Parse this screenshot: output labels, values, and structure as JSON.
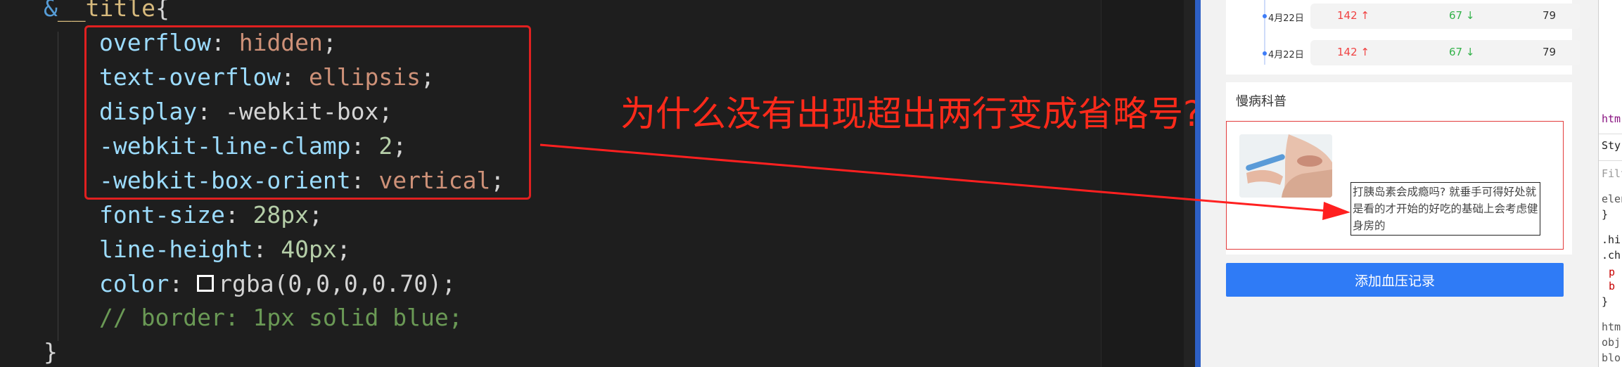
{
  "editor": {
    "lines": [
      {
        "amp": "&",
        "selector": "__title",
        "brace": "{"
      },
      {
        "prop": "overflow",
        "value": "hidden",
        "end": ";"
      },
      {
        "prop": "text-overflow",
        "value": "ellipsis",
        "end": ";"
      },
      {
        "prop": "display",
        "value": "-webkit-box",
        "end": ";"
      },
      {
        "prop": "-webkit-line-clamp",
        "value": "2",
        "end": ";"
      },
      {
        "prop": "-webkit-box-orient",
        "value": "vertical",
        "end": ";"
      },
      {
        "prop": "font-size",
        "value": "28px",
        "end": ";"
      },
      {
        "prop": "line-height",
        "value": "40px",
        "end": ";"
      },
      {
        "prop": "color",
        "value": "rgba(0,0,0,0.70)",
        "end": ";"
      },
      {
        "comment": "// border: 1px solid blue;"
      },
      {
        "brace": "}"
      }
    ]
  },
  "annotation": {
    "question": "为什么没有出现超出两行变成省略号?",
    "color": "#ff2a1a"
  },
  "phone": {
    "bp_rows": [
      {
        "date": "4月22日",
        "high": "142",
        "high_arrow": "↑",
        "low": "67",
        "low_arrow": "↓",
        "pulse": "79"
      },
      {
        "date": "4月22日",
        "high": "142",
        "high_arrow": "↑",
        "low": "67",
        "low_arrow": "↓",
        "pulse": "79"
      }
    ],
    "section_title": "慢病科普",
    "article_text": "打胰岛素会成瘾吗? 就垂手可得好处就是看的才开始的好吃的基础上会考虑健身房的",
    "add_button": "添加血压记录",
    "accent": "#2f7bf6"
  },
  "devtools": {
    "items": [
      "htm",
      "Sty",
      "Filte",
      "elen",
      "}",
      ".hi",
      ".ch",
      "p",
      "b",
      "}",
      "htm",
      "obj",
      "blo"
    ]
  }
}
